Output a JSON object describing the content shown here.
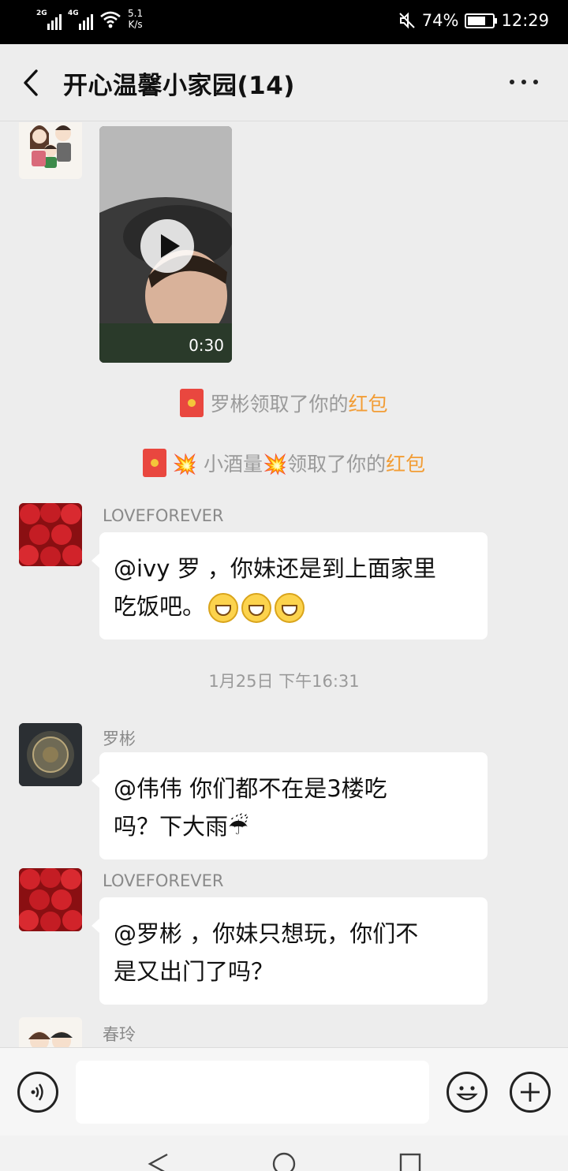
{
  "status_bar": {
    "network_1": "2G",
    "network_2": "4G",
    "speed_value": "5.1",
    "speed_unit": "K/s",
    "battery": "74%",
    "time": "12:29",
    "battery_level": 0.74
  },
  "header": {
    "title": "开心温馨小家园(14)"
  },
  "video_message": {
    "duration": "0:30"
  },
  "system_messages": [
    {
      "text": "罗彬领取了你的",
      "link": "红包"
    },
    {
      "text_prefix": "💥 小酒量💥领取了你的",
      "link": "红包"
    }
  ],
  "messages": [
    {
      "sender": "LOVEFOREVER",
      "line1": "@ivy 罗 ，你妹还是到上面家里",
      "line2": "吃饭吧。"
    },
    {
      "sender": "罗彬",
      "line1": "@伟伟 你们都不在是3楼吃",
      "line2": "吗？下大雨☔"
    },
    {
      "sender": "LOVEFOREVER",
      "line1": "@罗彬 ，你妹只想玩，你们不",
      "line2": "是又出门了吗？"
    },
    {
      "sender": "春玲"
    }
  ],
  "timestamp": "1月25日 下午16:31",
  "input": {
    "value": ""
  },
  "colors": {
    "background": "#ededed",
    "bubble": "#ffffff",
    "red_packet_link": "#f29d36",
    "status_bar": "#000000"
  }
}
